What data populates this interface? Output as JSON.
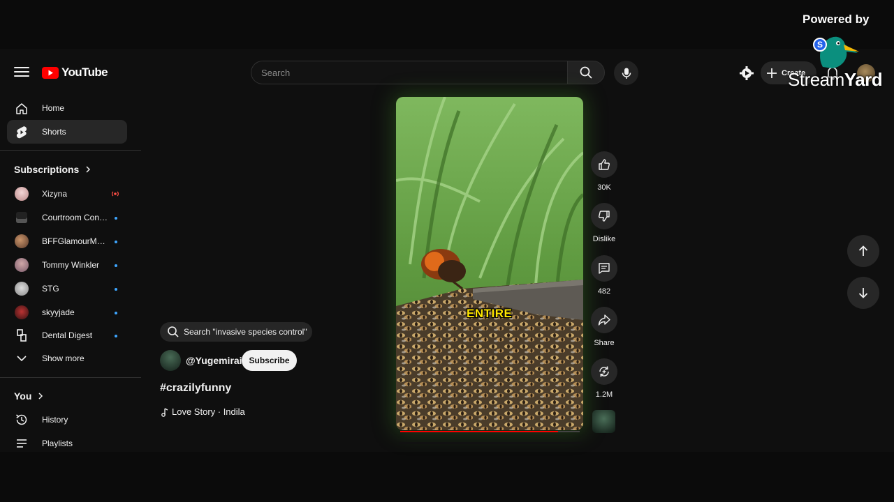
{
  "header": {
    "logo_text": "YouTube",
    "search_placeholder": "Search",
    "create_label": "Create"
  },
  "watermark": {
    "powered_by": "Powered by",
    "brand_part1": "Stream",
    "brand_part2": "Yard"
  },
  "sidebar": {
    "nav": [
      {
        "label": "Home",
        "icon": "home-icon"
      },
      {
        "label": "Shorts",
        "icon": "shorts-icon",
        "active": true
      }
    ],
    "subscriptions_title": "Subscriptions",
    "subscriptions": [
      {
        "name": "Xizyna",
        "status": "live"
      },
      {
        "name": "Courtroom Cons...",
        "status": "new"
      },
      {
        "name": "BFFGlamourMar...",
        "status": "new"
      },
      {
        "name": "Tommy Winkler",
        "status": "new"
      },
      {
        "name": "STG",
        "status": "new"
      },
      {
        "name": "skyyjade",
        "status": "new"
      },
      {
        "name": "Dental Digest",
        "status": "new"
      }
    ],
    "show_more": "Show more",
    "you_title": "You",
    "you_items": [
      {
        "label": "History",
        "icon": "history-icon"
      },
      {
        "label": "Playlists",
        "icon": "playlists-icon"
      }
    ]
  },
  "short": {
    "search_chip": "Search \"invasive species control\"",
    "channel": "@Yugemirai",
    "subscribe_label": "Subscribe",
    "title": "#crazilyfunny",
    "music": "Love Story · Indila",
    "caption": "ENTIRE",
    "progress": 0.88
  },
  "actions": {
    "likes": "30K",
    "dislike_label": "Dislike",
    "comments": "482",
    "share_label": "Share",
    "remix_count": "1.2M"
  },
  "colors": {
    "background": "#0f0f0f",
    "accent": "#ff0000",
    "chip": "#272727"
  }
}
